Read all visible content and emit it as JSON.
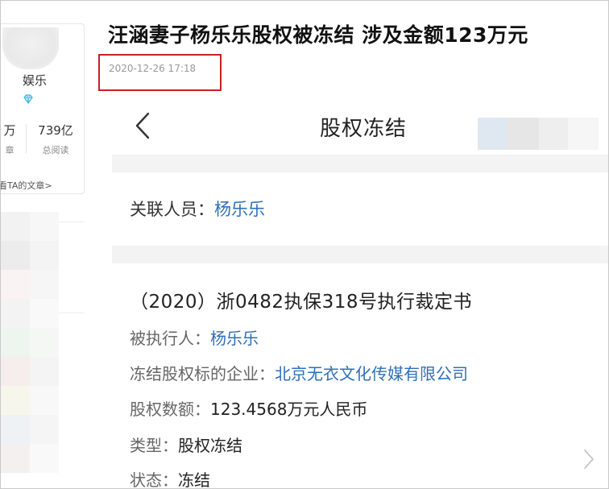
{
  "article": {
    "headline": "汪涵妻子杨乐乐股权被冻结 涉及金额123万元",
    "timestamp": "2020-12-26 17:18"
  },
  "author": {
    "name_partial": "娱乐",
    "articles_count_partial": "万",
    "articles_label_partial": "章",
    "total_reads": "739亿",
    "total_reads_label": "总阅读",
    "view_articles_link": "看看TA的文章>"
  },
  "phone": {
    "nav_title": "股权冻结",
    "related_person_label": "关联人员：",
    "related_person_value": "杨乐乐",
    "document_title": "（2020）浙0482执保318号执行裁定书",
    "fields": [
      {
        "label": "被执行人：",
        "value": "杨乐乐"
      },
      {
        "label": "冻结股权标的企业：",
        "value": "北京无衣文化传媒有限公司"
      },
      {
        "label": "股权数额：",
        "value": "123.4568万元人民币"
      },
      {
        "label": "类型：",
        "value": "股权冻结"
      },
      {
        "label": "状态：",
        "value": "冻结"
      }
    ]
  },
  "colors": {
    "link": "#2f6fb8",
    "highlight_border": "#cc1e28",
    "band": "#f3f3f3"
  },
  "icons": [
    "back-arrow-icon",
    "diamond-icon",
    "chevron-right-icon"
  ]
}
